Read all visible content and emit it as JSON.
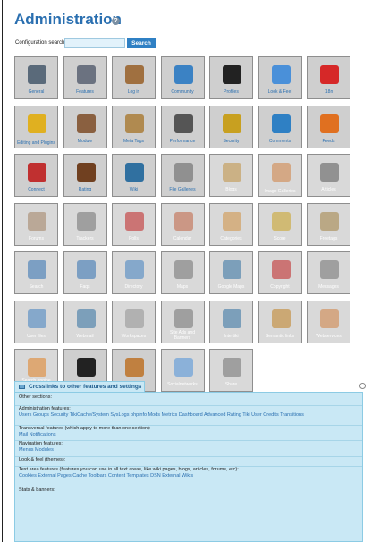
{
  "header": {
    "title": "Administration",
    "help_icon": "help-icon"
  },
  "search": {
    "label": "Configuration search:",
    "value": "",
    "button_label": "Search"
  },
  "tiles": [
    {
      "label": "General",
      "icon": "wrench-icon",
      "color": "#5a6a7a",
      "enabled": true
    },
    {
      "label": "Features",
      "icon": "power-icon",
      "color": "#6b7280",
      "enabled": true
    },
    {
      "label": "Log in",
      "icon": "door-icon",
      "color": "#a07040",
      "enabled": true
    },
    {
      "label": "Community",
      "icon": "people-icon",
      "color": "#3b82c4",
      "enabled": true
    },
    {
      "label": "Profiles",
      "icon": "hourglass-icon",
      "color": "#222222",
      "enabled": true
    },
    {
      "label": "Look & Feel",
      "icon": "paint-icon",
      "color": "#4a90d9",
      "enabled": true
    },
    {
      "label": "i18n",
      "icon": "flag-icon",
      "color": "#d62828",
      "enabled": true
    },
    {
      "label": "Editing and Plugins",
      "icon": "pencil-icon",
      "color": "#e0b020",
      "enabled": true
    },
    {
      "label": "Module",
      "icon": "module-icon",
      "color": "#8a6040",
      "enabled": true
    },
    {
      "label": "Meta Tags",
      "icon": "meta-tag-icon",
      "color": "#b08a50",
      "enabled": true
    },
    {
      "label": "Performance",
      "icon": "stopwatch-icon",
      "color": "#555555",
      "enabled": true
    },
    {
      "label": "Security",
      "icon": "keys-icon",
      "color": "#c8a020",
      "enabled": true
    },
    {
      "label": "Comments",
      "icon": "speech-bubble-icon",
      "color": "#2f80c4",
      "enabled": true
    },
    {
      "label": "Feeds",
      "icon": "rss-icon",
      "color": "#e07020",
      "enabled": true
    },
    {
      "label": "Connect",
      "icon": "globe-icon",
      "color": "#c03030",
      "enabled": true
    },
    {
      "label": "Rating",
      "icon": "rating-icon",
      "color": "#704020",
      "enabled": true
    },
    {
      "label": "Wiki",
      "icon": "wiki-icon",
      "color": "#3070a0",
      "enabled": true
    },
    {
      "label": "File Galleries",
      "icon": "file-cabinet-icon",
      "color": "#909090",
      "enabled": true
    },
    {
      "label": "Blogs",
      "icon": "blog-icon",
      "color": "#c09040",
      "enabled": false
    },
    {
      "label": "Image Galleries",
      "icon": "palette-icon",
      "color": "#d08040",
      "enabled": false
    },
    {
      "label": "Articles",
      "icon": "article-icon",
      "color": "#555555",
      "enabled": false
    },
    {
      "label": "Forums",
      "icon": "forum-icon",
      "color": "#a08060",
      "enabled": false
    },
    {
      "label": "Trackers",
      "icon": "tracker-icon",
      "color": "#707070",
      "enabled": false
    },
    {
      "label": "Polls",
      "icon": "poll-icon",
      "color": "#c02020",
      "enabled": false
    },
    {
      "label": "Calendar",
      "icon": "calendar-icon",
      "color": "#c06040",
      "enabled": false
    },
    {
      "label": "Categories",
      "icon": "categories-icon",
      "color": "#d09040",
      "enabled": false
    },
    {
      "label": "Score",
      "icon": "stars-icon",
      "color": "#c8a020",
      "enabled": false
    },
    {
      "label": "Freetags",
      "icon": "tag-icon",
      "color": "#a08040",
      "enabled": false
    },
    {
      "label": "Search",
      "icon": "magnifier-icon",
      "color": "#3070b0",
      "enabled": false
    },
    {
      "label": "Faqs",
      "icon": "faq-icon",
      "color": "#3070b0",
      "enabled": false
    },
    {
      "label": "Directory",
      "icon": "directory-icon",
      "color": "#4080c0",
      "enabled": false
    },
    {
      "label": "Maps",
      "icon": "map-icon",
      "color": "#707070",
      "enabled": false
    },
    {
      "label": "Google Maps",
      "icon": "google-maps-icon",
      "color": "#3070a0",
      "enabled": false
    },
    {
      "label": "Copyright",
      "icon": "copyright-icon",
      "color": "#c02020",
      "enabled": false
    },
    {
      "label": "Messages",
      "icon": "messages-icon",
      "color": "#707070",
      "enabled": false
    },
    {
      "label": "User files",
      "icon": "user-files-icon",
      "color": "#4080c0",
      "enabled": false
    },
    {
      "label": "Webmail",
      "icon": "webmail-icon",
      "color": "#3070a0",
      "enabled": false
    },
    {
      "label": "Workspaces",
      "icon": "workspaces-icon",
      "color": "#909090",
      "enabled": false
    },
    {
      "label": "Site Ads and Banners",
      "icon": "banners-icon",
      "color": "#707070",
      "enabled": false
    },
    {
      "label": "Intertiki",
      "icon": "intertiki-icon",
      "color": "#3070a0",
      "enabled": false
    },
    {
      "label": "Semantic links",
      "icon": "semantic-links-icon",
      "color": "#c08020",
      "enabled": false
    },
    {
      "label": "Webservices",
      "icon": "webservices-icon",
      "color": "#d08040",
      "enabled": false
    },
    {
      "label": "Search engine friendly url",
      "icon": "sefurl-icon",
      "color": "#e08020",
      "enabled": false
    },
    {
      "label": "Video",
      "icon": "clapperboard-icon",
      "color": "#222222",
      "enabled": true
    },
    {
      "label": "Payment",
      "icon": "payment-icon",
      "color": "#c08040",
      "enabled": true
    },
    {
      "label": "Socialnetworks",
      "icon": "socialnetworks-icon",
      "color": "#4a90d9",
      "enabled": false
    },
    {
      "label": "Share",
      "icon": "share-icon",
      "color": "#707070",
      "enabled": false
    }
  ],
  "crosslinks": {
    "title": "Crosslinks to other features and settings",
    "sections": [
      {
        "heading": "Other sections:",
        "links": ""
      },
      {
        "heading": "Administration features:",
        "links": "Users Groups Security TikiCache/System SysLogs phpinfo Mods Metrics Dashboard Advanced Rating Tiki User Credits Transitions"
      },
      {
        "heading": "Transversal features (which apply to more than one section):",
        "links": "Mail Notifications"
      },
      {
        "heading": "Navigation features:",
        "links": "Menus Modules"
      },
      {
        "heading": "Look & feel (themes):",
        "links": ""
      },
      {
        "heading": "Text area features (features you can use in all text areas, like wiki pages, blogs, articles, forums, etc):",
        "links": "Cookies External Pages Cache Toolbars Content Templates DSN External Wikis"
      },
      {
        "heading": "Stats & banners:",
        "links": ""
      }
    ]
  }
}
